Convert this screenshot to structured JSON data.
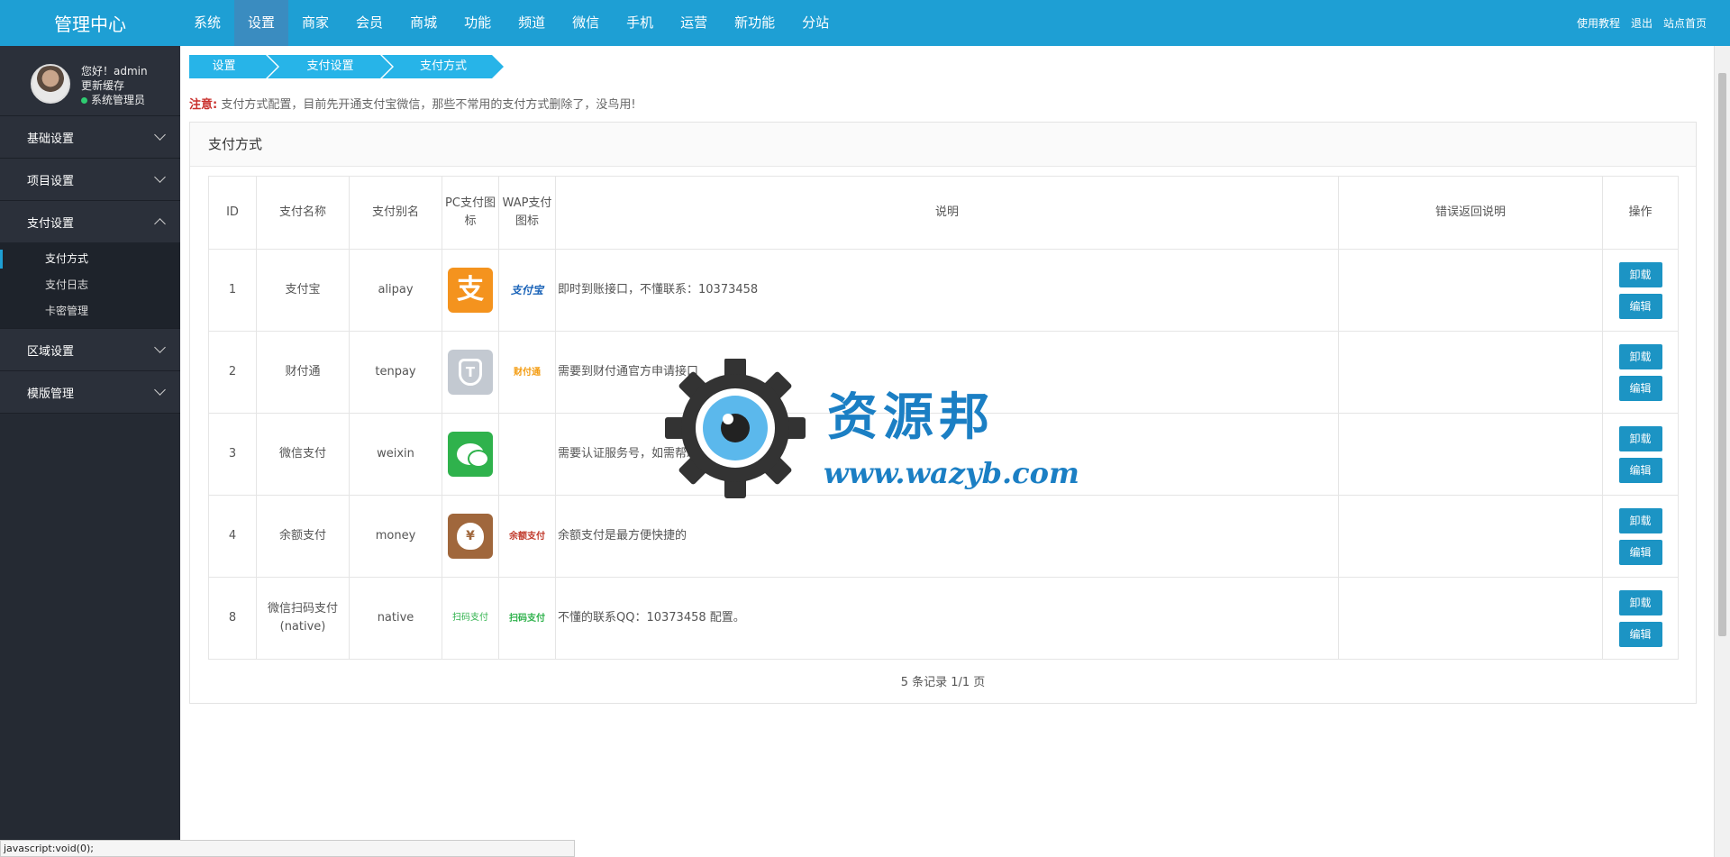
{
  "brand": "管理中心",
  "topnav": [
    "系统",
    "设置",
    "商家",
    "会员",
    "商城",
    "功能",
    "频道",
    "微信",
    "手机",
    "运营",
    "新功能",
    "分站"
  ],
  "topnav_active_index": 1,
  "toplinks": [
    "使用教程",
    "退出",
    "站点首页"
  ],
  "profile": {
    "greeting": "您好！admin",
    "refresh_cache": "更新缓存",
    "role": "系统管理员"
  },
  "sidebar": {
    "groups": [
      {
        "label": "基础设置",
        "expanded": false
      },
      {
        "label": "项目设置",
        "expanded": false
      },
      {
        "label": "支付设置",
        "expanded": true,
        "items": [
          "支付方式",
          "支付日志",
          "卡密管理"
        ],
        "active_item": 0
      },
      {
        "label": "区域设置",
        "expanded": false
      },
      {
        "label": "模版管理",
        "expanded": false
      }
    ]
  },
  "breadcrumb": [
    "设置",
    "支付设置",
    "支付方式"
  ],
  "notice": {
    "tag": "注意:",
    "text": "支付方式配置，目前先开通支付宝微信，那些不常用的支付方式删除了，没鸟用!"
  },
  "panel_title": "支付方式",
  "table": {
    "headers": [
      "ID",
      "支付名称",
      "支付别名",
      "PC支付图标",
      "WAP支付图标",
      "说明",
      "错误返回说明",
      "操作"
    ],
    "rows": [
      {
        "id": "1",
        "name": "支付宝",
        "alias": "alipay",
        "pc_icon": "alipay-icon",
        "pc_glyph": "支",
        "wap_text": "支付宝",
        "description": "即时到账接口，不懂联系：10373458",
        "error": ""
      },
      {
        "id": "2",
        "name": "财付通",
        "alias": "tenpay",
        "pc_icon": "tenpay-icon",
        "pc_glyph": "T",
        "wap_text": "财付通",
        "description": "需要到财付通官方申请接口",
        "error": ""
      },
      {
        "id": "3",
        "name": "微信支付",
        "alias": "weixin",
        "pc_icon": "wechat-icon",
        "pc_glyph": "",
        "wap_text": "",
        "description": "需要认证服务号，如需帮助qq 10373458",
        "error": ""
      },
      {
        "id": "4",
        "name": "余额支付",
        "alias": "money",
        "pc_icon": "money-bag-icon",
        "pc_glyph": "¥",
        "wap_text": "余额支付",
        "description": "余额支付是最方便快捷的",
        "error": ""
      },
      {
        "id": "8",
        "name": "微信扫码支付(native)",
        "alias": "native",
        "pc_icon": "wechat-qr-icon",
        "pc_glyph": "扫码支付",
        "wap_text": "扫码支付",
        "description": "不懂的联系QQ：10373458 配置。",
        "error": ""
      }
    ],
    "actions": {
      "uninstall": "卸载",
      "edit": "编辑"
    }
  },
  "pager": "5 条记录 1/1 页",
  "watermark": {
    "title": "资源邦",
    "url": "www.wazyb.com"
  },
  "statusbar": "javascript:void(0);"
}
